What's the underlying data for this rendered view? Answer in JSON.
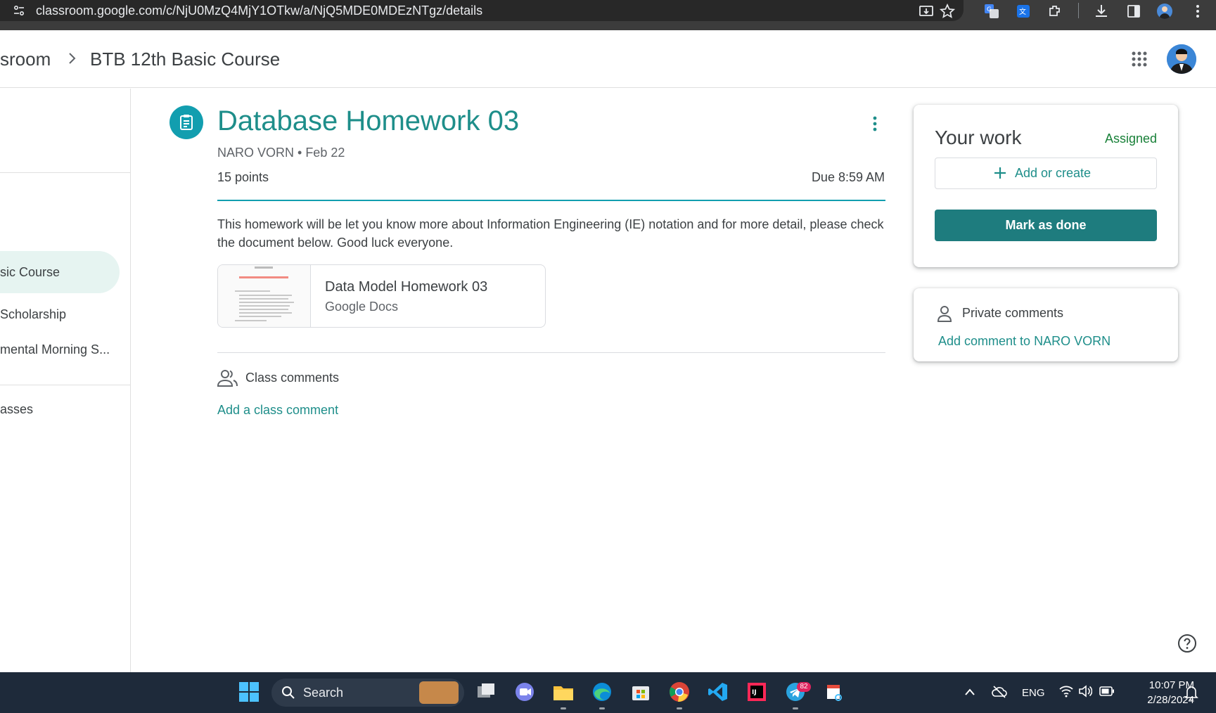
{
  "browser": {
    "url": "classroom.google.com/c/NjU0MzQ4MjY1OTkw/a/NjQ5MDE0MDEzNTgz/details"
  },
  "header": {
    "breadcrumb_app": "sroom",
    "breadcrumb_course": "BTB 12th Basic Course"
  },
  "sidebar": {
    "items": [
      {
        "label": "sic Course",
        "active": true
      },
      {
        "label": " Scholarship",
        "active": false
      },
      {
        "label": "mental Morning S...",
        "active": false
      },
      {
        "label": "asses",
        "active": false
      }
    ]
  },
  "assignment": {
    "title": "Database Homework 03",
    "author_date": "NARO VORN • Feb 22",
    "points": "15 points",
    "due": "Due 8:59 AM",
    "description": "This homework will be let you know more about Information Engineering (IE) notation and for more detail, please check the document below. Good luck everyone.",
    "attachment": {
      "title": "Data Model Homework 03",
      "type": "Google Docs"
    },
    "class_comments_label": "Class comments",
    "add_class_comment": "Add a class comment"
  },
  "your_work": {
    "title": "Your work",
    "status": "Assigned",
    "add_label": "Add or create",
    "mark_done_label": "Mark as done"
  },
  "private_comments": {
    "label": "Private comments",
    "add_label": "Add comment to NARO VORN"
  },
  "taskbar": {
    "search_label": "Search",
    "telegram_badge": "82",
    "lang": "ENG",
    "time": "10:07 PM",
    "date": "2/28/2024"
  },
  "colors": {
    "accent": "#1e8e8a",
    "button": "#1e7c7e",
    "status": "#188038"
  }
}
